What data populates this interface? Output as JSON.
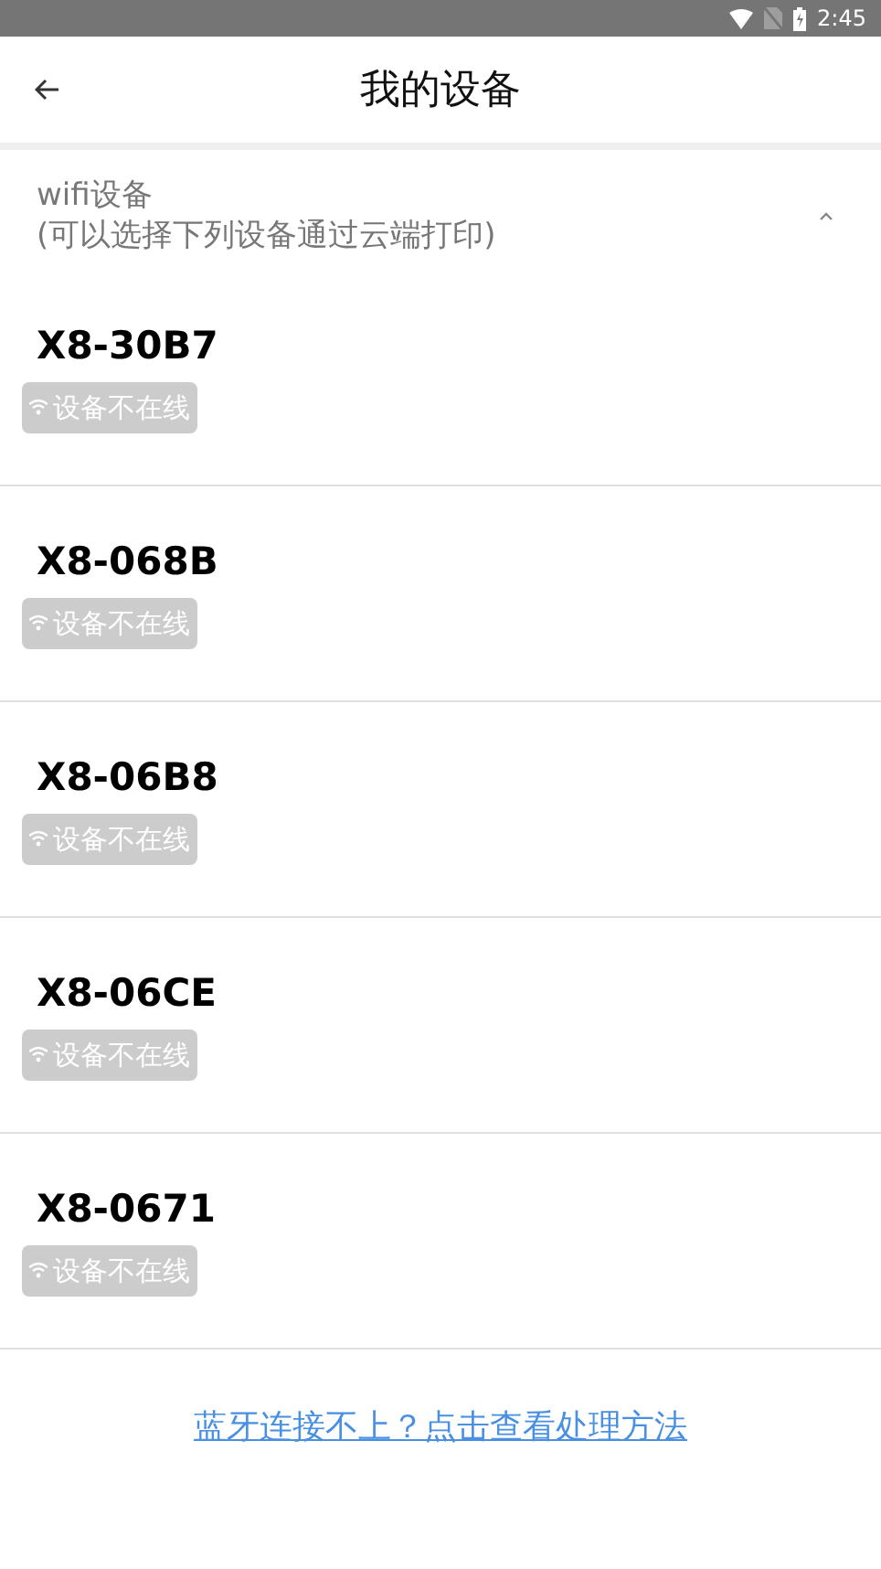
{
  "status_bar": {
    "time": "2:45"
  },
  "app_bar": {
    "title": "我的设备"
  },
  "section": {
    "title": "wifi设备",
    "subtitle": "(可以选择下列设备通过云端打印)",
    "expanded": true
  },
  "devices": [
    {
      "name": "X8-30B7",
      "status": "设备不在线",
      "online": false
    },
    {
      "name": "X8-068B",
      "status": "设备不在线",
      "online": false
    },
    {
      "name": "X8-06B8",
      "status": "设备不在线",
      "online": false
    },
    {
      "name": "X8-06CE",
      "status": "设备不在线",
      "online": false
    },
    {
      "name": "X8-0671",
      "status": "设备不在线",
      "online": false
    }
  ],
  "help_link": "蓝牙连接不上？点击查看处理方法"
}
